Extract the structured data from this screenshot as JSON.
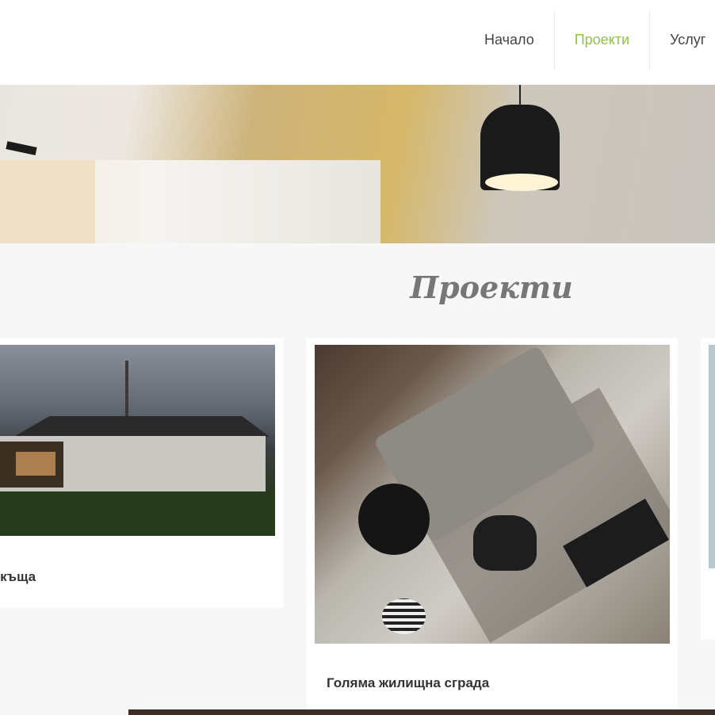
{
  "nav": {
    "items": [
      {
        "label": "Начало",
        "active": false
      },
      {
        "label": "Проекти",
        "active": true
      },
      {
        "label": "Услуг",
        "active": false
      }
    ],
    "active_color": "#8dc63f"
  },
  "section": {
    "title": "Проекти"
  },
  "projects": [
    {
      "title": "а къща"
    },
    {
      "title": "Голяма жилищна сграда"
    }
  ]
}
